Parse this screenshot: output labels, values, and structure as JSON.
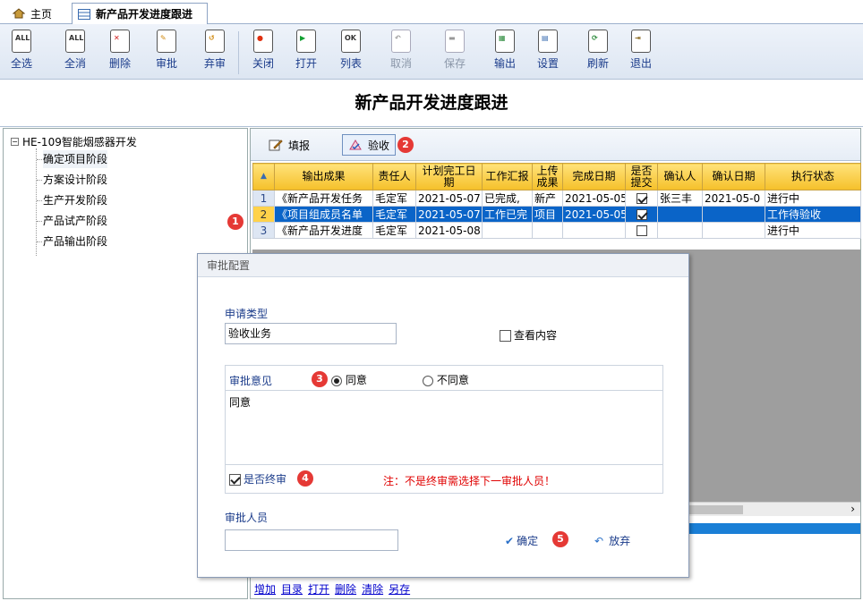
{
  "tabs": {
    "home": "主页",
    "active": "新产品开发进度跟进"
  },
  "toolbar": [
    {
      "label": "全选",
      "icon": "select-all-icon",
      "glyph": "ALL",
      "enabled": true
    },
    {
      "label": "全消",
      "icon": "deselect-all-icon",
      "glyph": "ALL",
      "enabled": true
    },
    {
      "label": "删除",
      "icon": "delete-icon",
      "glyph": "✕",
      "enabled": true
    },
    {
      "label": "审批",
      "icon": "approve-icon",
      "glyph": "✎",
      "enabled": true
    },
    {
      "label": "弃审",
      "icon": "unapprove-icon",
      "glyph": "↺",
      "enabled": true
    },
    {
      "label": "关闭",
      "icon": "close-icon",
      "glyph": "●",
      "enabled": true
    },
    {
      "label": "打开",
      "icon": "open-icon",
      "glyph": "▶",
      "enabled": true
    },
    {
      "label": "列表",
      "icon": "list-icon",
      "glyph": "OK",
      "enabled": true
    },
    {
      "label": "取消",
      "icon": "cancel-icon",
      "glyph": "↶",
      "enabled": false
    },
    {
      "label": "保存",
      "icon": "save-icon",
      "glyph": "▬",
      "enabled": false
    },
    {
      "label": "输出",
      "icon": "export-icon",
      "glyph": "▦",
      "enabled": true
    },
    {
      "label": "设置",
      "icon": "settings-icon",
      "glyph": "▤",
      "enabled": true
    },
    {
      "label": "刷新",
      "icon": "refresh-icon",
      "glyph": "⟳",
      "enabled": true
    },
    {
      "label": "退出",
      "icon": "exit-icon",
      "glyph": "⇥",
      "enabled": true
    }
  ],
  "page_title": "新产品开发进度跟进",
  "tree": {
    "root": "HE-109智能烟感器开发",
    "root_toggle": "−",
    "nodes": [
      "确定项目阶段",
      "方案设计阶段",
      "生产开发阶段",
      "产品试产阶段",
      "产品输出阶段"
    ]
  },
  "subtoolbar": {
    "fill": "填报",
    "accept": "验收"
  },
  "table": {
    "corner": "▲",
    "headers": [
      "输出成果",
      "责任人",
      "计划完工日期",
      "工作汇报",
      "上传成果",
      "完成日期",
      "是否提交",
      "确认人",
      "确认日期",
      "执行状态"
    ],
    "rows": [
      {
        "no": "1",
        "output": "《新产品开发任务",
        "owner": "毛定军",
        "plan": "2021-05-07",
        "report": "已完成,",
        "upload": "新产",
        "done": "2021-05-05",
        "submitted": true,
        "confirmer": "张三丰",
        "confirm_date": "2021-05-0",
        "status": "进行中",
        "selected": false
      },
      {
        "no": "2",
        "output": "《项目组成员名单",
        "owner": "毛定军",
        "plan": "2021-05-07",
        "report": "工作已完",
        "upload": "项目",
        "done": "2021-05-05",
        "submitted": true,
        "confirmer": "",
        "confirm_date": "",
        "status": "工作待验收",
        "selected": true
      },
      {
        "no": "3",
        "output": "《新产品开发进度",
        "owner": "毛定军",
        "plan": "2021-05-08",
        "report": "",
        "upload": "",
        "done": "",
        "submitted": false,
        "confirmer": "",
        "confirm_date": "",
        "status": "进行中",
        "selected": false
      }
    ]
  },
  "scroll_arrow": "›",
  "bottom_links": [
    "增加",
    "目录",
    "打开",
    "删除",
    "清除",
    "另存"
  ],
  "dialog": {
    "title": "审批配置",
    "type_label": "申请类型",
    "type_value": "验收业务",
    "view_content": "查看内容",
    "opinion_label": "审批意见",
    "agree": "同意",
    "disagree": "不同意",
    "opinion_text": "同意",
    "final_label": "是否终审",
    "note": "注：不是终审需选择下一审批人员！",
    "approver_label": "审批人员",
    "approver_value": "",
    "ok": "确定",
    "ok_glyph": "✔",
    "cancel": "放弃",
    "cancel_glyph": "↶"
  },
  "badges": [
    "1",
    "2",
    "3",
    "4",
    "5"
  ],
  "colors": {
    "selected_row": "#0a64c8",
    "header_gold": "#f5c02a",
    "badge_red": "#e53935",
    "note_red": "#e00000"
  }
}
